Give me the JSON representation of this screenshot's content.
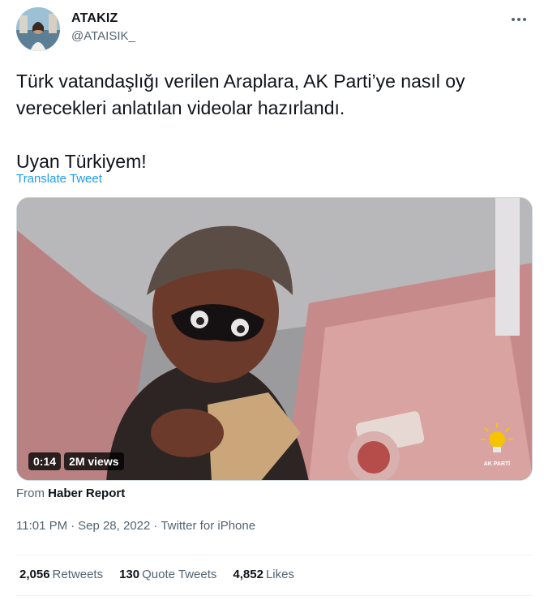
{
  "author": {
    "display_name": "ATAKIZ",
    "handle": "@ATAISIK_"
  },
  "tweet": {
    "text_p1": "Türk vatandaşlığı verilen Araplara, AK Parti’ye nasıl oy verecekleri anlatılan videolar hazırlandı.",
    "text_p2": "Uyan Türkiyem!",
    "translate_label": "Translate Tweet"
  },
  "media": {
    "duration": "0:14",
    "views": "2M views",
    "watermark_text": "AK PARTİ"
  },
  "source": {
    "prefix": "From",
    "name": "Haber Report"
  },
  "meta": {
    "time": "11:01 PM",
    "date": "Sep 28, 2022",
    "client": "Twitter for iPhone",
    "separator": "·"
  },
  "stats": {
    "retweets_count": "2,056",
    "retweets_label": "Retweets",
    "quotes_count": "130",
    "quotes_label": "Quote Tweets",
    "likes_count": "4,852",
    "likes_label": "Likes"
  },
  "colors": {
    "link": "#1d9bf0",
    "secondary_text": "#536471",
    "primary_text": "#0f1419"
  }
}
